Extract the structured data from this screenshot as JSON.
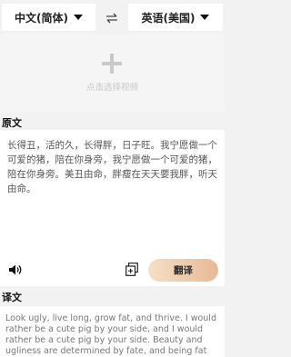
{
  "languages": {
    "source": "中文(简体)",
    "target": "英语(美国)"
  },
  "upload": {
    "label": "点击选择视频"
  },
  "source_section": {
    "title": "原文",
    "text": "长得丑，活的久，长得胖，日子旺。我宁愿做一个可爱的猪，陪在你身旁，我宁愿做一个可爱的猪，陪在你身旁。美丑由命，胖瘦在天天要我胖，听天由命。"
  },
  "actions": {
    "translate_label": "翻译"
  },
  "target_section": {
    "title": "译文",
    "text": "Look ugly, live long, grow fat, and thrive. I would rather be a cute pig by your side, and I would rather be a cute pig by your side. Beauty and ugliness are determined by fate, and being fat"
  },
  "colors": {
    "accent_start": "#f6dfc6",
    "accent_end": "#e8b995",
    "background": "#f2f2f2"
  }
}
